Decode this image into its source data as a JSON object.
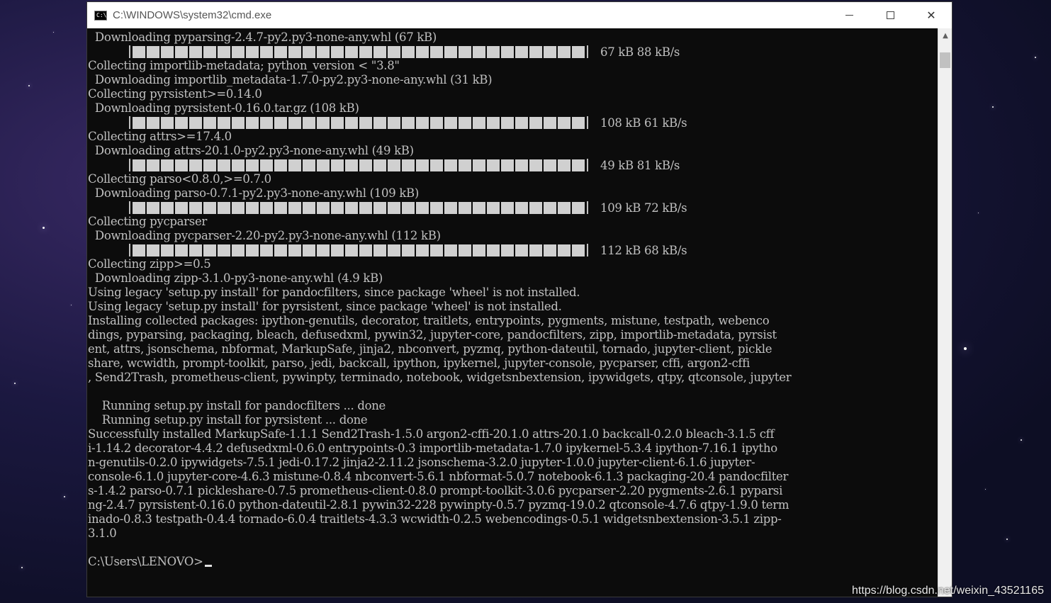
{
  "window": {
    "title": "C:\\WINDOWS\\system32\\cmd.exe",
    "icon_label": "C:\\",
    "controls": {
      "minimize": "minimize",
      "maximize": "maximize",
      "close": "✕"
    }
  },
  "console": {
    "lines": [
      "  Downloading pyparsing-2.4.7-py2.py3-none-any.whl (67 kB)",
      "",
      "Collecting importlib-metadata; python_version < \"3.8\"",
      "  Downloading importlib_metadata-1.7.0-py2.py3-none-any.whl (31 kB)",
      "Collecting pyrsistent>=0.14.0",
      "  Downloading pyrsistent-0.16.0.tar.gz (108 kB)",
      "",
      "Collecting attrs>=17.4.0",
      "  Downloading attrs-20.1.0-py2.py3-none-any.whl (49 kB)",
      "",
      "Collecting parso<0.8.0,>=0.7.0",
      "  Downloading parso-0.7.1-py2.py3-none-any.whl (109 kB)",
      "",
      "Collecting pycparser",
      "  Downloading pycparser-2.20-py2.py3-none-any.whl (112 kB)",
      "",
      "Collecting zipp>=0.5",
      "  Downloading zipp-3.1.0-py3-none-any.whl (4.9 kB)",
      "Using legacy 'setup.py install' for pandocfilters, since package 'wheel' is not installed.",
      "Using legacy 'setup.py install' for pyrsistent, since package 'wheel' is not installed.",
      "Installing collected packages: ipython-genutils, decorator, traitlets, entrypoints, pygments, mistune, testpath, webenco",
      "dings, pyparsing, packaging, bleach, defusedxml, pywin32, jupyter-core, pandocfilters, zipp, importlib-metadata, pyrsist",
      "ent, attrs, jsonschema, nbformat, MarkupSafe, jinja2, nbconvert, pyzmq, python-dateutil, tornado, jupyter-client, pickle",
      "share, wcwidth, prompt-toolkit, parso, jedi, backcall, ipython, ipykernel, jupyter-console, pycparser, cffi, argon2-cffi",
      ", Send2Trash, prometheus-client, pywinpty, terminado, notebook, widgetsnbextension, ipywidgets, qtpy, qtconsole, jupyter",
      "",
      "    Running setup.py install for pandocfilters ... done",
      "    Running setup.py install for pyrsistent ... done",
      "Successfully installed MarkupSafe-1.1.1 Send2Trash-1.5.0 argon2-cffi-20.1.0 attrs-20.1.0 backcall-0.2.0 bleach-3.1.5 cff",
      "i-1.14.2 decorator-4.4.2 defusedxml-0.6.0 entrypoints-0.3 importlib-metadata-1.7.0 ipykernel-5.3.4 ipython-7.16.1 ipytho",
      "n-genutils-0.2.0 ipywidgets-7.5.1 jedi-0.17.2 jinja2-2.11.2 jsonschema-3.2.0 jupyter-1.0.0 jupyter-client-6.1.6 jupyter-",
      "console-6.1.0 jupyter-core-4.6.3 mistune-0.8.4 nbconvert-5.6.1 nbformat-5.0.7 notebook-6.1.3 packaging-20.4 pandocfilter",
      "s-1.4.2 parso-0.7.1 pickleshare-0.7.5 prometheus-client-0.8.0 prompt-toolkit-3.0.6 pycparser-2.20 pygments-2.6.1 pyparsi",
      "ng-2.4.7 pyrsistent-0.16.0 python-dateutil-2.8.1 pywin32-228 pywinpty-0.5.7 pyzmq-19.0.2 qtconsole-4.7.6 qtpy-1.9.0 term",
      "inado-0.8.3 testpath-0.4.4 tornado-6.0.4 traitlets-4.3.3 wcwidth-0.2.5 webencodings-0.5.1 widgetsnbextension-3.5.1 zipp-",
      "3.1.0",
      ""
    ],
    "progress_bars": [
      {
        "row": 1,
        "progress": 1.0,
        "stats": "67 kB 88 kB/s"
      },
      {
        "row": 6,
        "progress": 1.0,
        "stats": "108 kB 61 kB/s"
      },
      {
        "row": 9,
        "progress": 1.0,
        "stats": "49 kB 81 kB/s"
      },
      {
        "row": 12,
        "progress": 1.0,
        "stats": "109 kB 72 kB/s"
      },
      {
        "row": 15,
        "progress": 1.0,
        "stats": "112 kB 68 kB/s"
      }
    ],
    "prompt": "C:\\Users\\LENOVO>"
  },
  "scrollbar": {
    "up_arrow": "▲"
  },
  "watermark": "https://blog.csdn.net/weixin_43521165"
}
